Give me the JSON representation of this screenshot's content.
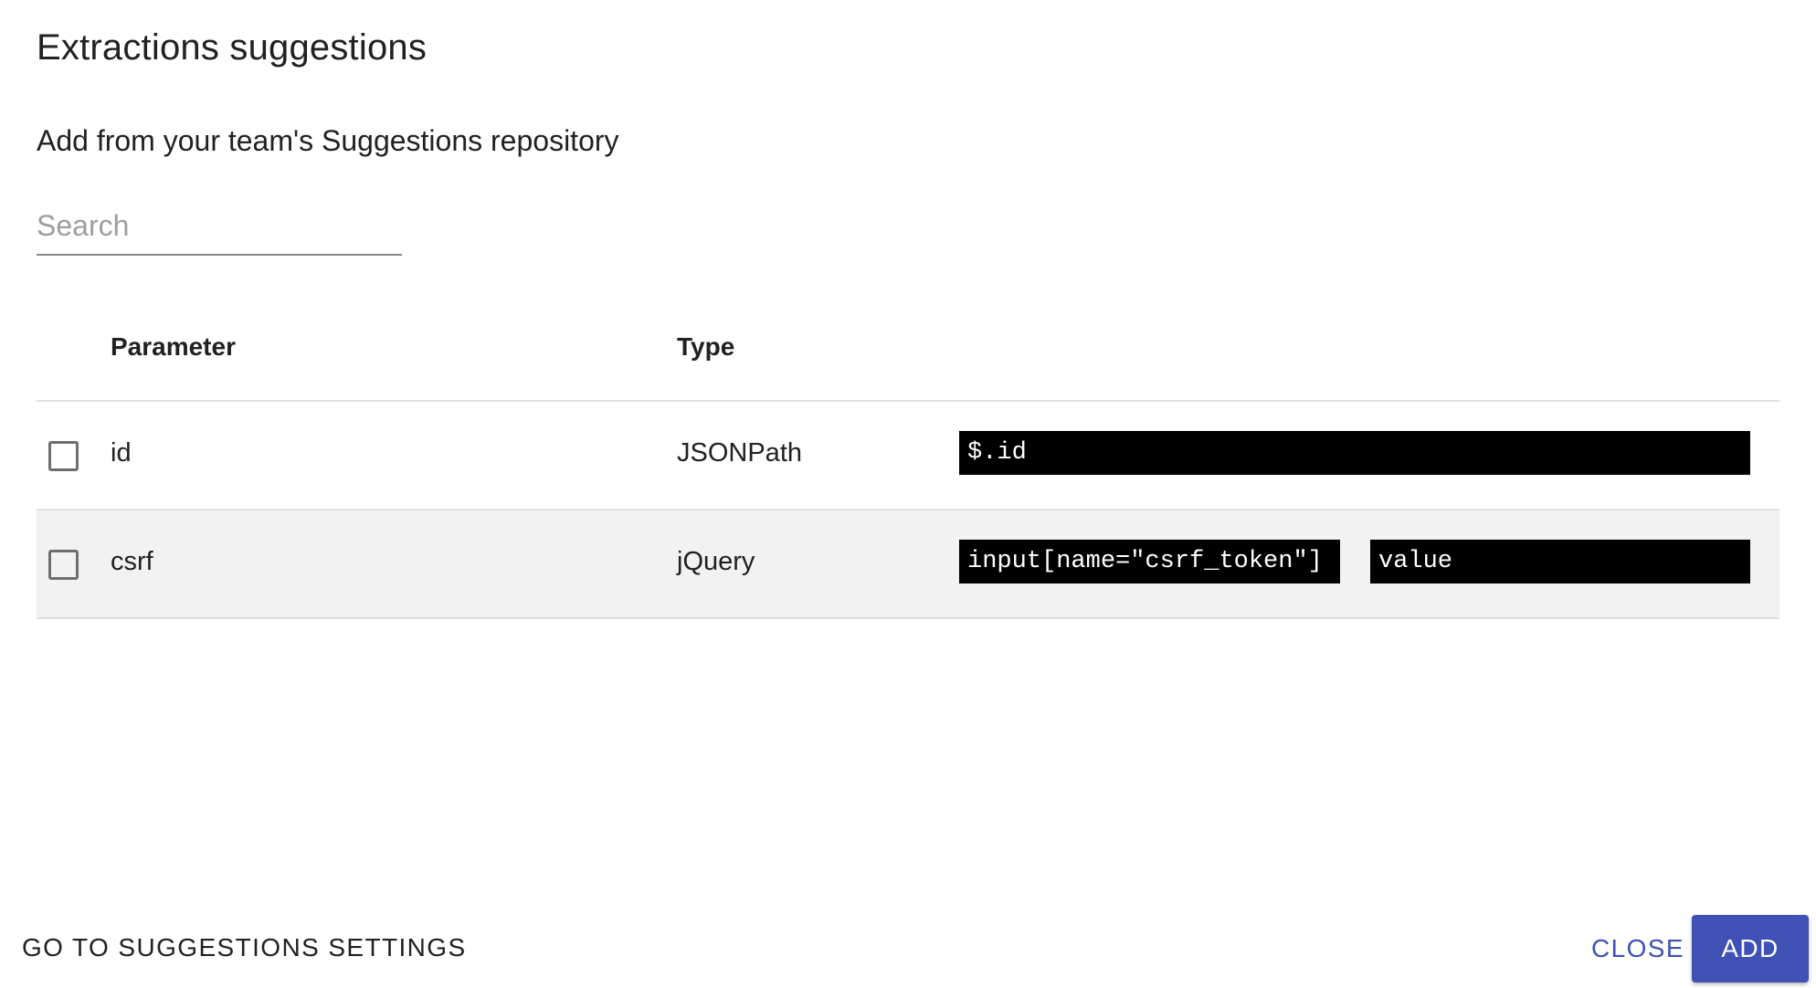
{
  "dialog": {
    "title": "Extractions suggestions",
    "subtitle": "Add from your team's Suggestions repository"
  },
  "search": {
    "placeholder": "Search",
    "value": ""
  },
  "table": {
    "columns": [
      "Parameter",
      "Type"
    ],
    "rows": [
      {
        "checked": false,
        "parameter": "id",
        "type": "JSONPath",
        "expressions": [
          "$.id"
        ]
      },
      {
        "checked": false,
        "parameter": "csrf",
        "type": "jQuery",
        "expressions": [
          "input[name=\"csrf_token\"]",
          "value"
        ]
      }
    ]
  },
  "footer": {
    "settings_label": "GO TO SUGGESTIONS SETTINGS",
    "close_label": "CLOSE",
    "add_label": "ADD"
  },
  "colors": {
    "accent": "#3f51b5",
    "code_background": "#000000",
    "row_alt_background": "#f2f2f2"
  },
  "icons": {
    "checkbox": "checkbox-unchecked-icon"
  }
}
